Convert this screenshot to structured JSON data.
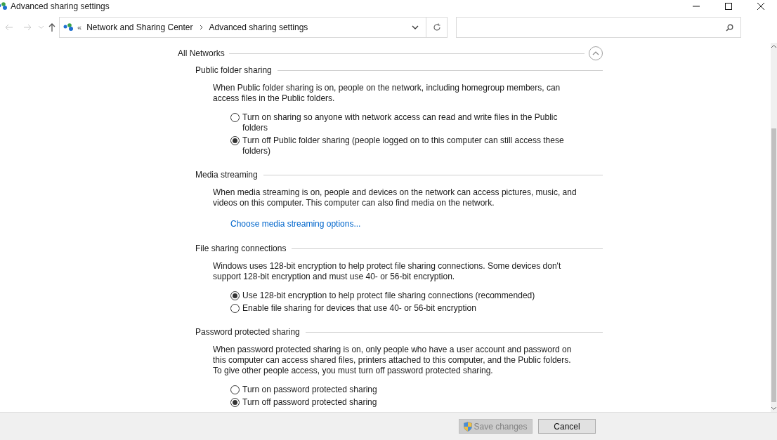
{
  "window": {
    "title": "Advanced sharing settings"
  },
  "address_bar": {
    "root_mark": "«",
    "breadcrumbs": [
      "Network and Sharing Center",
      "Advanced sharing settings"
    ]
  },
  "group": {
    "title": "All Networks",
    "expanded": true
  },
  "sections": [
    {
      "title": "Public folder sharing",
      "description": "When Public folder sharing is on, people on the network, including homegroup members, can access files in the Public folders.",
      "options": [
        {
          "label": "Turn on sharing so anyone with network access can read and write files in the Public folders",
          "selected": false
        },
        {
          "label": "Turn off Public folder sharing (people logged on to this computer can still access these folders)",
          "selected": true
        }
      ]
    },
    {
      "title": "Media streaming",
      "description": "When media streaming is on, people and devices on the network can access pictures, music, and videos on this computer. This computer can also find media on the network.",
      "link": "Choose media streaming options..."
    },
    {
      "title": "File sharing connections",
      "description": "Windows uses 128-bit encryption to help protect file sharing connections. Some devices don't support 128-bit encryption and must use 40- or 56-bit encryption.",
      "options": [
        {
          "label": "Use 128-bit encryption to help protect file sharing connections (recommended)",
          "selected": true
        },
        {
          "label": "Enable file sharing for devices that use 40- or 56-bit encryption",
          "selected": false
        }
      ]
    },
    {
      "title": "Password protected sharing",
      "description": "When password protected sharing is on, only people who have a user account and password on this computer can access shared files, printers attached to this computer, and the Public folders. To give other people access, you must turn off password protected sharing.",
      "options": [
        {
          "label": "Turn on password protected sharing",
          "selected": false
        },
        {
          "label": "Turn off password protected sharing",
          "selected": true
        }
      ]
    }
  ],
  "buttons": [
    {
      "label": "Save changes",
      "disabled": true,
      "shield": true
    },
    {
      "label": "Cancel",
      "disabled": false,
      "shield": false
    }
  ]
}
